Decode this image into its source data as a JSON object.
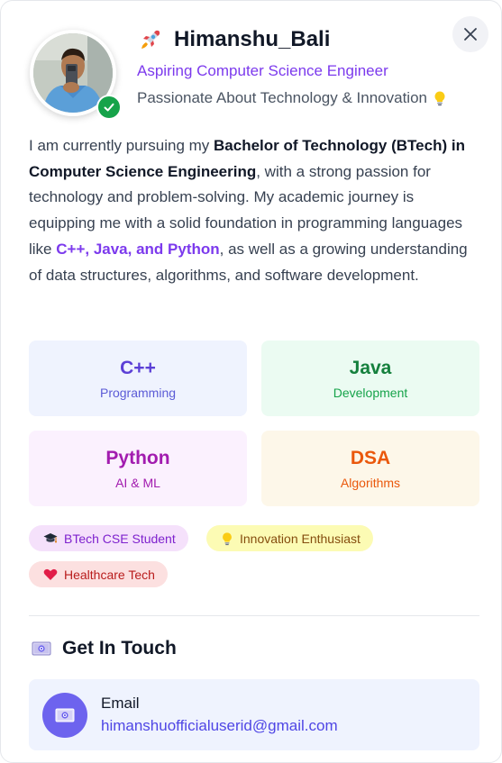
{
  "profile": {
    "name": "Himanshu_Bali",
    "name_icon": "rocket-icon",
    "subtitle": "Aspiring Computer Science Engineer",
    "tagline": "Passionate About Technology & Innovation",
    "tagline_icon": "lightbulb-icon",
    "verified": true,
    "verified_icon": "check-icon",
    "close_icon": "close-icon"
  },
  "bio": {
    "intro": "I am currently pursuing my ",
    "degree": "Bachelor of Technology (BTech) in Computer Science Engineering",
    "mid": ", with a strong passion for technology and problem-solving. My academic journey is equipping me with a solid foundation in programming languages like ",
    "languages": "C++, Java, and Python",
    "end": ", as well as a growing understanding of data structures, algorithms, and software development."
  },
  "skills": [
    {
      "title": "C++",
      "subtitle": "Programming",
      "color": "#5b3fd6",
      "bg": "#eff3fe"
    },
    {
      "title": "Java",
      "subtitle": "Development",
      "color": "#15803d",
      "bg": "#ebfbf2"
    },
    {
      "title": "Python",
      "subtitle": "AI & ML",
      "color": "#a21caf",
      "bg": "#fbf1fe"
    },
    {
      "title": "DSA",
      "subtitle": "Algorithms",
      "color": "#ea580c",
      "bg": "#fdf7e9"
    }
  ],
  "badges": [
    {
      "label": "BTech CSE Student",
      "icon": "graduation-cap-icon"
    },
    {
      "label": "Innovation Enthusiast",
      "icon": "lightbulb-icon"
    },
    {
      "label": "Healthcare Tech",
      "icon": "heart-icon"
    }
  ],
  "contact": {
    "heading": "Get In Touch",
    "heading_icon": "envelope-icon",
    "items": [
      {
        "label": "Email",
        "value": "himanshuofficialuserid@gmail.com",
        "icon": "envelope-icon"
      }
    ]
  },
  "colors": {
    "accent": "#7c3aed",
    "verified": "#16a34a",
    "contact_icon_bg": "#6d63ee"
  }
}
